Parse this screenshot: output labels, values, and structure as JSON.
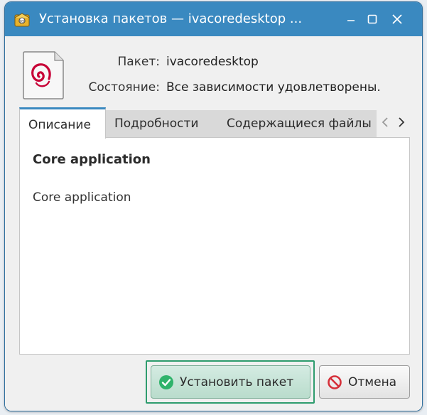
{
  "window": {
    "title": "Установка пакетов — ivacoredesktop ...",
    "minimize_label": "minimize",
    "maximize_label": "maximize",
    "close_label": "close"
  },
  "package": {
    "package_label": "Пакет:",
    "package_value": "ivacoredesktop",
    "status_label": "Состояние:",
    "status_value": "Все зависимости удовлетворены."
  },
  "tabs": [
    {
      "label": "Описание",
      "active": true
    },
    {
      "label": "Подробности",
      "active": false
    },
    {
      "label": "Содержащиеся файлы",
      "active": false
    }
  ],
  "description": {
    "title": "Core application",
    "body": "Core application"
  },
  "buttons": {
    "install_label": "Установить пакет",
    "cancel_label": "Отмена"
  },
  "colors": {
    "titlebar": "#3a89c0",
    "tab_accent": "#3a89c0",
    "focus_ring": "#2e9c6e",
    "install_icon": "#2fb36b",
    "cancel_icon": "#d6303a",
    "debian_swirl": "#c70036"
  }
}
